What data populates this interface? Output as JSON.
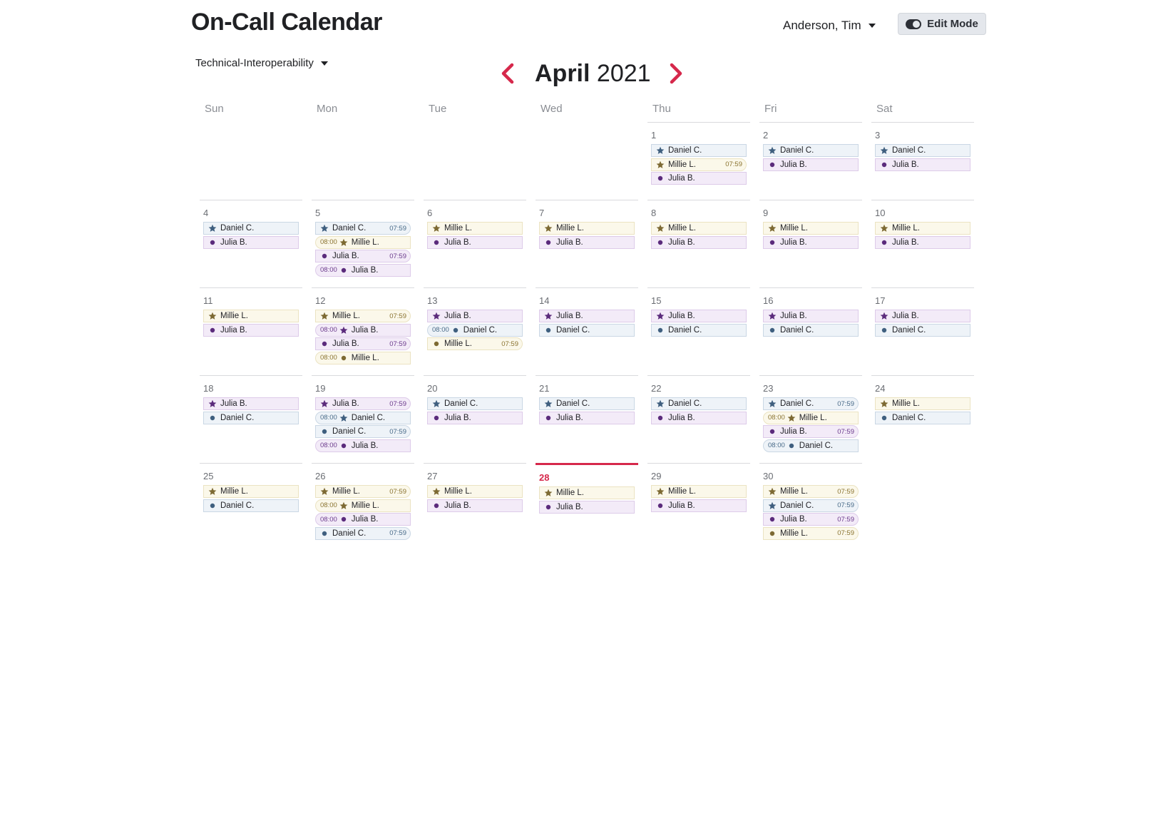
{
  "header": {
    "title": "On-Call Calendar",
    "user_name": "Anderson, Tim",
    "edit_mode_label": "Edit Mode",
    "team": "Technical-Interoperability"
  },
  "nav": {
    "month": "April",
    "year": "2021",
    "prev_icon": "chevron-left-icon",
    "next_icon": "chevron-right-icon"
  },
  "colors": {
    "accent": "#d6284b",
    "Daniel C.": {
      "bg": "#eef3f8",
      "border": "#cad7e4",
      "icon": "#3f5f7f"
    },
    "Millie L.": {
      "bg": "#fbf8ea",
      "border": "#ebe3c2",
      "icon": "#7d6a33"
    },
    "Julia B.": {
      "bg": "#f3ebf8",
      "border": "#ddcbe9",
      "icon": "#5b2b7c"
    }
  },
  "weekdays": [
    "Sun",
    "Mon",
    "Tue",
    "Wed",
    "Thu",
    "Fri",
    "Sat"
  ],
  "today": 28,
  "days": [
    {
      "day": "1",
      "events": [
        {
          "p": "Daniel C.",
          "i": "star"
        },
        {
          "p": "Millie L.",
          "i": "star",
          "end": "07:59"
        },
        {
          "p": "Julia B.",
          "i": "dot"
        }
      ]
    },
    {
      "day": "2",
      "events": [
        {
          "p": "Daniel C.",
          "i": "star"
        },
        {
          "p": "Julia B.",
          "i": "dot"
        }
      ]
    },
    {
      "day": "3",
      "events": [
        {
          "p": "Daniel C.",
          "i": "star"
        },
        {
          "p": "Julia B.",
          "i": "dot"
        }
      ]
    },
    {
      "day": "4",
      "events": [
        {
          "p": "Daniel C.",
          "i": "star"
        },
        {
          "p": "Julia B.",
          "i": "dot"
        }
      ]
    },
    {
      "day": "5",
      "events": [
        {
          "p": "Daniel C.",
          "i": "star",
          "end": "07:59"
        },
        {
          "p": "Millie L.",
          "i": "star",
          "start": "08:00"
        },
        {
          "p": "Julia B.",
          "i": "dot",
          "end": "07:59"
        },
        {
          "p": "Julia B.",
          "i": "dot",
          "start": "08:00"
        }
      ]
    },
    {
      "day": "6",
      "events": [
        {
          "p": "Millie L.",
          "i": "star"
        },
        {
          "p": "Julia B.",
          "i": "dot"
        }
      ]
    },
    {
      "day": "7",
      "events": [
        {
          "p": "Millie L.",
          "i": "star"
        },
        {
          "p": "Julia B.",
          "i": "dot"
        }
      ]
    },
    {
      "day": "8",
      "events": [
        {
          "p": "Millie L.",
          "i": "star"
        },
        {
          "p": "Julia B.",
          "i": "dot"
        }
      ]
    },
    {
      "day": "9",
      "events": [
        {
          "p": "Millie L.",
          "i": "star"
        },
        {
          "p": "Julia B.",
          "i": "dot"
        }
      ]
    },
    {
      "day": "10",
      "events": [
        {
          "p": "Millie L.",
          "i": "star"
        },
        {
          "p": "Julia B.",
          "i": "dot"
        }
      ]
    },
    {
      "day": "11",
      "events": [
        {
          "p": "Millie L.",
          "i": "star"
        },
        {
          "p": "Julia B.",
          "i": "dot"
        }
      ]
    },
    {
      "day": "12",
      "events": [
        {
          "p": "Millie L.",
          "i": "star",
          "end": "07:59"
        },
        {
          "p": "Julia B.",
          "i": "star",
          "start": "08:00"
        },
        {
          "p": "Julia B.",
          "i": "dot",
          "end": "07:59"
        },
        {
          "p": "Millie L.",
          "i": "dot",
          "start": "08:00"
        }
      ]
    },
    {
      "day": "13",
      "events": [
        {
          "p": "Julia B.",
          "i": "star"
        },
        {
          "p": "Daniel C.",
          "i": "dot",
          "start": "08:00"
        },
        {
          "p": "Millie L.",
          "i": "dot",
          "end": "07:59"
        }
      ]
    },
    {
      "day": "14",
      "events": [
        {
          "p": "Julia B.",
          "i": "star"
        },
        {
          "p": "Daniel C.",
          "i": "dot"
        }
      ]
    },
    {
      "day": "15",
      "events": [
        {
          "p": "Julia B.",
          "i": "star"
        },
        {
          "p": "Daniel C.",
          "i": "dot"
        }
      ]
    },
    {
      "day": "16",
      "events": [
        {
          "p": "Julia B.",
          "i": "star"
        },
        {
          "p": "Daniel C.",
          "i": "dot"
        }
      ]
    },
    {
      "day": "17",
      "events": [
        {
          "p": "Julia B.",
          "i": "star"
        },
        {
          "p": "Daniel C.",
          "i": "dot"
        }
      ]
    },
    {
      "day": "18",
      "events": [
        {
          "p": "Julia B.",
          "i": "star"
        },
        {
          "p": "Daniel C.",
          "i": "dot"
        }
      ]
    },
    {
      "day": "19",
      "events": [
        {
          "p": "Julia B.",
          "i": "star",
          "end": "07:59"
        },
        {
          "p": "Daniel C.",
          "i": "star",
          "start": "08:00"
        },
        {
          "p": "Daniel C.",
          "i": "dot",
          "end": "07:59"
        },
        {
          "p": "Julia B.",
          "i": "dot",
          "start": "08:00"
        }
      ]
    },
    {
      "day": "20",
      "events": [
        {
          "p": "Daniel C.",
          "i": "star"
        },
        {
          "p": "Julia B.",
          "i": "dot"
        }
      ]
    },
    {
      "day": "21",
      "events": [
        {
          "p": "Daniel C.",
          "i": "star"
        },
        {
          "p": "Julia B.",
          "i": "dot"
        }
      ]
    },
    {
      "day": "22",
      "events": [
        {
          "p": "Daniel C.",
          "i": "star"
        },
        {
          "p": "Julia B.",
          "i": "dot"
        }
      ]
    },
    {
      "day": "23",
      "events": [
        {
          "p": "Daniel C.",
          "i": "star",
          "end": "07:59"
        },
        {
          "p": "Millie L.",
          "i": "star",
          "start": "08:00"
        },
        {
          "p": "Julia B.",
          "i": "dot",
          "end": "07:59"
        },
        {
          "p": "Daniel C.",
          "i": "dot",
          "start": "08:00"
        }
      ]
    },
    {
      "day": "24",
      "events": [
        {
          "p": "Millie L.",
          "i": "star"
        },
        {
          "p": "Daniel C.",
          "i": "dot"
        }
      ]
    },
    {
      "day": "25",
      "events": [
        {
          "p": "Millie L.",
          "i": "star"
        },
        {
          "p": "Daniel C.",
          "i": "dot"
        }
      ]
    },
    {
      "day": "26",
      "events": [
        {
          "p": "Millie L.",
          "i": "star",
          "end": "07:59"
        },
        {
          "p": "Millie L.",
          "i": "star",
          "start": "08:00"
        },
        {
          "p": "Julia B.",
          "i": "dot",
          "start": "08:00"
        },
        {
          "p": "Daniel C.",
          "i": "dot",
          "end": "07:59"
        }
      ]
    },
    {
      "day": "27",
      "events": [
        {
          "p": "Millie L.",
          "i": "star"
        },
        {
          "p": "Julia B.",
          "i": "dot"
        }
      ]
    },
    {
      "day": "28",
      "events": [
        {
          "p": "Millie L.",
          "i": "star"
        },
        {
          "p": "Julia B.",
          "i": "dot"
        }
      ]
    },
    {
      "day": "29",
      "events": [
        {
          "p": "Millie L.",
          "i": "star"
        },
        {
          "p": "Julia B.",
          "i": "dot"
        }
      ]
    },
    {
      "day": "30",
      "events": [
        {
          "p": "Millie L.",
          "i": "star",
          "end": "07:59"
        },
        {
          "p": "Daniel C.",
          "i": "star",
          "end": "07:59"
        },
        {
          "p": "Julia B.",
          "i": "dot",
          "end": "07:59"
        },
        {
          "p": "Millie L.",
          "i": "dot",
          "end": "07:59"
        }
      ]
    }
  ]
}
